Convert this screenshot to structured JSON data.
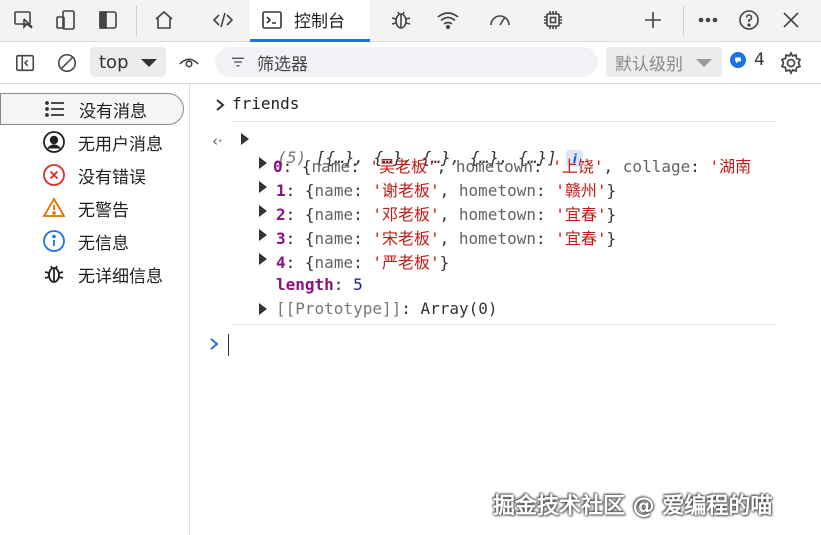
{
  "tabbar": {
    "active_tab_label": "控制台",
    "tabs": [
      "device-inspect",
      "device-emulation",
      "sidebar-toggle",
      "welcome",
      "elements",
      "console",
      "sources",
      "network",
      "performance",
      "memory"
    ],
    "accent": "#1a73e8"
  },
  "toolbar": {
    "context": "top",
    "filter_placeholder": "筛选器",
    "level": "默认级别",
    "issues_count": "4"
  },
  "sidebar": {
    "items": [
      {
        "label": "没有消息",
        "icon": "list-icon"
      },
      {
        "label": "无用户消息",
        "icon": "user-icon"
      },
      {
        "label": "没有错误",
        "icon": "error-icon"
      },
      {
        "label": "无警告",
        "icon": "warning-icon"
      },
      {
        "label": "无信息",
        "icon": "info-icon"
      },
      {
        "label": "无详细信息",
        "icon": "bug-icon"
      }
    ],
    "selected_index": 0
  },
  "console": {
    "input_command": "friends",
    "result_summary": {
      "count": "(5)",
      "preview": "[{…}, {…}, {…}, {…}, {…}]"
    },
    "entries": [
      {
        "index": "0",
        "name": "吴老板",
        "hometown": "上饶",
        "extra_key": "collage",
        "extra_value": "湖南"
      },
      {
        "index": "1",
        "name": "谢老板",
        "hometown": "赣州"
      },
      {
        "index": "2",
        "name": "邓老板",
        "hometown": "宜春"
      },
      {
        "index": "3",
        "name": "宋老板",
        "hometown": "宜春"
      },
      {
        "index": "4",
        "name": "严老板"
      }
    ],
    "length_key": "length",
    "length_value": "5",
    "prototype_key": "[[Prototype]]",
    "prototype_value": "Array(0)",
    "key_name": "name",
    "key_hometown": "hometown"
  },
  "watermark": "掘金技术社区 @ 爱编程的喵"
}
